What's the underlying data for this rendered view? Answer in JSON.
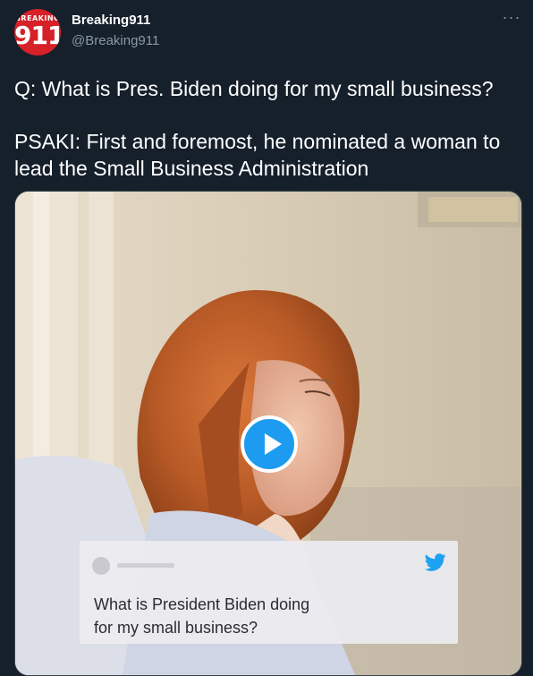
{
  "account": {
    "avatar_top": "BREAKING",
    "avatar_number": "911",
    "display_name": "Breaking911",
    "handle": "@Breaking911"
  },
  "menu": {
    "more_label": "···",
    "icon": "more-horizontal-icon"
  },
  "tweet": {
    "question": "Q: What is Pres. Biden doing for my small business?",
    "answer": "PSAKI: First and foremost, he nominated a woman to lead the Small Business Administration"
  },
  "media": {
    "type": "video",
    "play_icon": "play-icon",
    "caption_card": {
      "icon": "twitter-bird-icon",
      "text_line1": "What is President Biden doing",
      "text_line2": "for my small business?"
    }
  },
  "colors": {
    "background": "#15202b",
    "text": "#ffffff",
    "secondary_text": "#8899a6",
    "accent": "#1d9bf0",
    "brand_red": "#d62128"
  }
}
